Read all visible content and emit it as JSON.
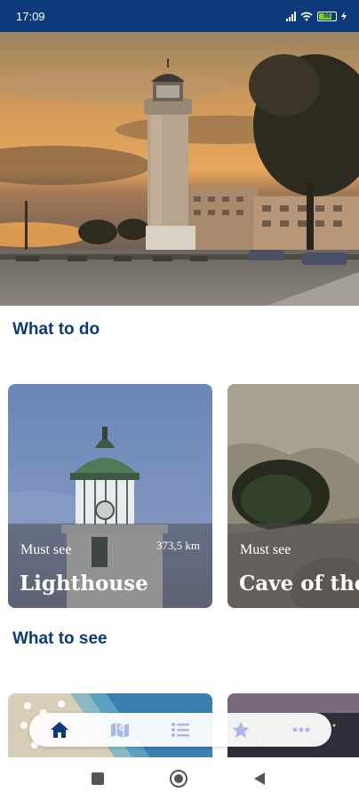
{
  "status_bar": {
    "time": "17:09",
    "battery_level": "86"
  },
  "sections": {
    "what_to_do": "What to do",
    "what_to_see": "What to see"
  },
  "cards": [
    {
      "tag": "Must see",
      "distance": "373,5 km",
      "title": "Lighthouse"
    },
    {
      "tag": "Must see",
      "title": "Cave of the"
    }
  ],
  "bottom_nav": {
    "items": [
      "home-icon",
      "map-icon",
      "list-icon",
      "favorites-star-icon",
      "more-icon"
    ],
    "active_index": 0
  },
  "system_nav": [
    "recents-square-icon",
    "home-circle-icon",
    "back-triangle-icon"
  ],
  "colors": {
    "brand_blue": "#0d3a7a",
    "nav_active": "#0d3a7a",
    "nav_inactive": "#a9b8e8"
  }
}
